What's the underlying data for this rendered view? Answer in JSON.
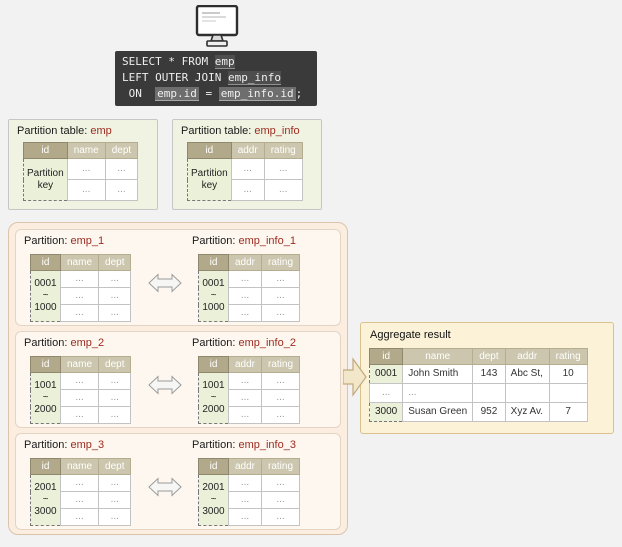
{
  "colors": {
    "background": "#f2f2f2",
    "accent_red": "#9e2b20",
    "sql_box_bg": "#3a3a3a",
    "schema_box_bg": "#f0f3e1",
    "partition_container_bg": "#fbeee0",
    "aggregate_box_bg": "#fbf2d7",
    "header_id_bg": "#b1a98a",
    "header_col_bg": "#cbc6ad",
    "partition_key_cell_bg": "#ebf1d9"
  },
  "sql": {
    "lines": [
      [
        {
          "t": "SELECT * FROM "
        },
        {
          "t": "emp",
          "hl": "u"
        }
      ],
      [
        {
          "t": "LEFT OUTER JOIN "
        },
        {
          "t": "emp_info",
          "hl": "u"
        }
      ],
      [
        {
          "t": " ON  "
        },
        {
          "t": "emp.id",
          "hl": "box"
        },
        {
          "t": " = "
        },
        {
          "t": "emp_info.id",
          "hl": "box"
        },
        {
          "t": ";"
        }
      ]
    ]
  },
  "schema_emp": {
    "title_prefix": "Partition table: ",
    "title_name": "emp",
    "table": {
      "headers": [
        "id",
        "name",
        "dept"
      ],
      "key": [
        "Partition",
        "key"
      ],
      "rows": [
        [
          "...",
          "..."
        ],
        [
          "...",
          "..."
        ]
      ]
    }
  },
  "schema_emp_info": {
    "title_prefix": "Partition table: ",
    "title_name": "emp_info",
    "table": {
      "headers": [
        "id",
        "addr",
        "rating"
      ],
      "key": [
        "Partition",
        "key"
      ],
      "rows": [
        [
          "...",
          "..."
        ],
        [
          "...",
          "..."
        ]
      ]
    }
  },
  "partitions": [
    {
      "left_label_prefix": "Partition: ",
      "left_label_name": "emp_1",
      "right_label_prefix": "Partition: ",
      "right_label_name": "emp_info_1",
      "left_table": {
        "headers": [
          "id",
          "name",
          "dept"
        ],
        "key": [
          "0001",
          "~",
          "1000"
        ],
        "rows": [
          [
            "...",
            "..."
          ],
          [
            "...",
            "..."
          ],
          [
            "...",
            "..."
          ]
        ]
      },
      "right_table": {
        "headers": [
          "id",
          "addr",
          "rating"
        ],
        "key": [
          "0001",
          "~",
          "1000"
        ],
        "rows": [
          [
            "...",
            "..."
          ],
          [
            "...",
            "..."
          ],
          [
            "...",
            "..."
          ]
        ]
      }
    },
    {
      "left_label_prefix": "Partition: ",
      "left_label_name": "emp_2",
      "right_label_prefix": "Partition: ",
      "right_label_name": "emp_info_2",
      "left_table": {
        "headers": [
          "id",
          "name",
          "dept"
        ],
        "key": [
          "1001",
          "~",
          "2000"
        ],
        "rows": [
          [
            "...",
            "..."
          ],
          [
            "...",
            "..."
          ],
          [
            "...",
            "..."
          ]
        ]
      },
      "right_table": {
        "headers": [
          "id",
          "addr",
          "rating"
        ],
        "key": [
          "1001",
          "~",
          "2000"
        ],
        "rows": [
          [
            "...",
            "..."
          ],
          [
            "...",
            "..."
          ],
          [
            "...",
            "..."
          ]
        ]
      }
    },
    {
      "left_label_prefix": "Partition: ",
      "left_label_name": "emp_3",
      "right_label_prefix": "Partition: ",
      "right_label_name": "emp_info_3",
      "left_table": {
        "headers": [
          "id",
          "name",
          "dept"
        ],
        "key": [
          "2001",
          "~",
          "3000"
        ],
        "rows": [
          [
            "...",
            "..."
          ],
          [
            "...",
            "..."
          ],
          [
            "...",
            "..."
          ]
        ]
      },
      "right_table": {
        "headers": [
          "id",
          "addr",
          "rating"
        ],
        "key": [
          "2001",
          "~",
          "3000"
        ],
        "rows": [
          [
            "...",
            "..."
          ],
          [
            "...",
            "..."
          ],
          [
            "...",
            "..."
          ]
        ]
      }
    }
  ],
  "aggregate": {
    "title": "Aggregate result",
    "table": {
      "headers": [
        "id",
        "name",
        "dept",
        "addr",
        "rating"
      ],
      "rows": [
        [
          {
            "t": "0001",
            "cls": "key"
          },
          "John Smith",
          "143",
          "Abc St,",
          "10"
        ],
        [
          "...",
          "...",
          "",
          "",
          ""
        ],
        [
          {
            "t": "3000",
            "cls": "key"
          },
          "Susan Green",
          "952",
          "Xyz Av.",
          "7"
        ]
      ]
    }
  }
}
